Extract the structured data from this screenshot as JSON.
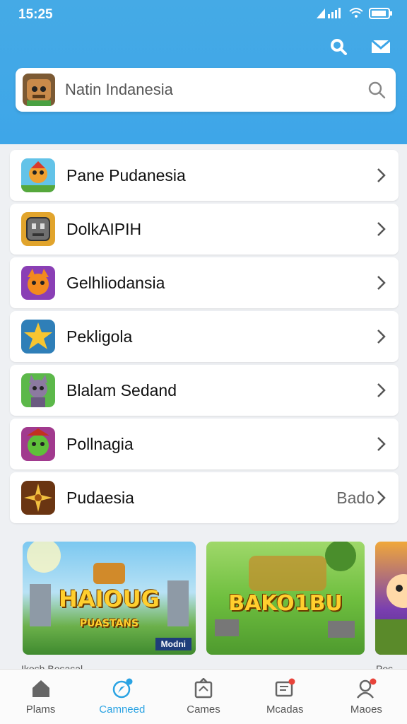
{
  "status": {
    "time": "15:25"
  },
  "search": {
    "text": "Natin Indanesia"
  },
  "list": [
    {
      "label": "Pane Pudanesia",
      "extra": ""
    },
    {
      "label": "DolkAIPIH",
      "extra": ""
    },
    {
      "label": "Gelhliodansia",
      "extra": ""
    },
    {
      "label": "Pekligola",
      "extra": ""
    },
    {
      "label": "Blalam Sedand",
      "extra": ""
    },
    {
      "label": "Pollnagia",
      "extra": ""
    },
    {
      "label": "Pudaesia",
      "extra": "Bado"
    }
  ],
  "banners": [
    {
      "title": "HAIOUG",
      "subtitle": "PUASTANS",
      "tag": "Modni"
    },
    {
      "title": "BAKO1BU",
      "subtitle": "",
      "tag": ""
    }
  ],
  "under_labels": [
    "Ikosh  Bosasal",
    "Pos"
  ],
  "tabs": [
    {
      "label": "Plams"
    },
    {
      "label": "Camneed"
    },
    {
      "label": "Cames"
    },
    {
      "label": "Mcadas"
    },
    {
      "label": "Maoes"
    }
  ],
  "colors": {
    "header": "#3ea6e8",
    "active_tab": "#2aa3e3",
    "badge": "#e8433a"
  }
}
